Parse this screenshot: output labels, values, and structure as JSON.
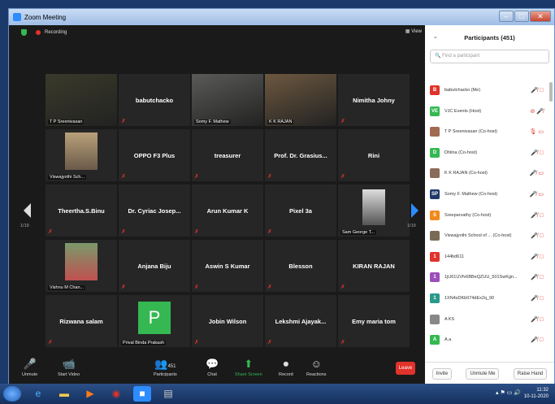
{
  "window": {
    "title": "Zoom Meeting",
    "min": "–",
    "max": "□",
    "close": "✕"
  },
  "topbar": {
    "recording": "Recording",
    "view": "View"
  },
  "tiles": [
    {
      "name": "",
      "label": "T P Sreenivasan",
      "type": "video"
    },
    {
      "name": "babutchacko",
      "label": "",
      "type": "name"
    },
    {
      "name": "",
      "label": "Somy F. Mathew",
      "type": "video"
    },
    {
      "name": "",
      "label": "K K RAJAN",
      "type": "video"
    },
    {
      "name": "Nimitha Johny",
      "label": "",
      "type": "name"
    },
    {
      "name": "",
      "label": "Viswajyothi Sch...",
      "type": "video"
    },
    {
      "name": "OPPO F3 Plus",
      "label": "",
      "type": "name"
    },
    {
      "name": "treasurer",
      "label": "",
      "type": "name"
    },
    {
      "name": "Prof. Dr. Grasius...",
      "label": "",
      "type": "name"
    },
    {
      "name": "Rini",
      "label": "",
      "type": "name"
    },
    {
      "name": "Theertha.S.Binu",
      "label": "",
      "type": "name"
    },
    {
      "name": "Dr. Cyriac Josep...",
      "label": "",
      "type": "name"
    },
    {
      "name": "Arun Kumar K",
      "label": "",
      "type": "name"
    },
    {
      "name": "Pixel 3a",
      "label": "",
      "type": "name"
    },
    {
      "name": "",
      "label": "Sam George T...",
      "type": "video"
    },
    {
      "name": "",
      "label": "Vishnu M Chan...",
      "type": "video"
    },
    {
      "name": "Anjana Biju",
      "label": "",
      "type": "name"
    },
    {
      "name": "Aswin S Kumar",
      "label": "",
      "type": "name"
    },
    {
      "name": "Blesson",
      "label": "",
      "type": "name"
    },
    {
      "name": "KIRAN RAJAN",
      "label": "",
      "type": "name"
    },
    {
      "name": "Rizwana salam",
      "label": "",
      "type": "name"
    },
    {
      "name": "P",
      "label": "Prival Binda Prakash",
      "type": "avatar"
    },
    {
      "name": "Jobin Wilson",
      "label": "",
      "type": "name"
    },
    {
      "name": "Lekshmi Ajayak...",
      "label": "",
      "type": "name"
    },
    {
      "name": "Emy maria tom",
      "label": "",
      "type": "name"
    }
  ],
  "paging": {
    "left": "1/19",
    "right": "1/19"
  },
  "controls": {
    "unmute": "Unmute",
    "video": "Start Video",
    "participants": "Participants",
    "participants_count": "451",
    "chat": "Chat",
    "share": "Share Screen",
    "record": "Record",
    "reactions": "Reactions",
    "leave": "Leave"
  },
  "panel": {
    "title": "Participants (451)",
    "search_placeholder": "Find a participant",
    "participants": [
      {
        "initial": "B",
        "color": "#e0332b",
        "name": "babutchacko (Me)",
        "icons": "🎤̸ ⃠"
      },
      {
        "initial": "VE",
        "color": "#35b852",
        "name": "VJC Events (Host)",
        "icons": "⊘ 🎤̸"
      },
      {
        "initial": "",
        "color": "#a06a50",
        "name": "T P Sreenivasan (Co-host)",
        "icons": "🎙 ▭"
      },
      {
        "initial": "D",
        "color": "#35b852",
        "name": "Dhilna (Co-host)",
        "icons": "🎤̸ ⃠"
      },
      {
        "initial": "",
        "color": "#8a6a5a",
        "name": "K K RAJAN (Co-host)",
        "icons": "🎤̸ ▭"
      },
      {
        "initial": "SP",
        "color": "#1f3a6a",
        "name": "Somy F. Mathew (Co-host)",
        "icons": "🎤̸ ▭"
      },
      {
        "initial": "S",
        "color": "#f08a1c",
        "name": "Sreeparvathy (Co-host)",
        "icons": "🎤̸ ⃠"
      },
      {
        "initial": "",
        "color": "#7a6a55",
        "name": "Viswajyothi School of ... (Co-host)",
        "icons": "🎤̸ ⃠"
      },
      {
        "initial": "1",
        "color": "#e0332b",
        "name": "144bd611",
        "icons": "🎤̸ ⃠"
      },
      {
        "initial": "1",
        "color": "#9b4fb8",
        "name": "1jU61UVfv6BBeQZUU_501SwKgn...",
        "icons": "🎤̸ ⃠"
      },
      {
        "initial": "1",
        "color": "#2a9a8a",
        "name": "1XN4sDKb074dEx2q_90",
        "icons": "🎤̸ ⃠"
      },
      {
        "initial": "",
        "color": "#888",
        "name": "A KS",
        "icons": "🎤̸ ⃠"
      },
      {
        "initial": "A",
        "color": "#35b852",
        "name": "A.a",
        "icons": "🎤̸ ⃠"
      }
    ],
    "invite": "Invite",
    "unmute_me": "Unmute Me",
    "raise_hand": "Raise Hand"
  },
  "taskbar": {
    "time": "11:32",
    "date": "10-11-2020"
  }
}
